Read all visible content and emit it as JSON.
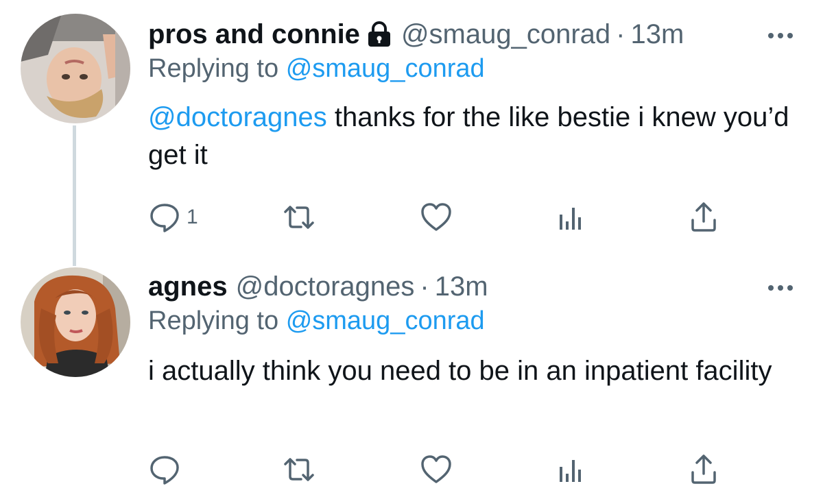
{
  "colors": {
    "text": "#0f1419",
    "secondary": "#536471",
    "link": "#1d9bf0",
    "thread_line": "#cfd9de"
  },
  "tweets": [
    {
      "display_name": "pros and connie",
      "protected_icon": "lock-icon",
      "handle": "@smaug_conrad",
      "separator": "·",
      "time": "13m",
      "replying_prefix": "Replying to",
      "replying_to": "@smaug_conrad",
      "body_mention": "@doctoragnes",
      "body_text": " thanks for the like bestie i knew you’d get it",
      "reply_count": "1"
    },
    {
      "display_name": "agnes",
      "handle": "@doctoragnes",
      "separator": "·",
      "time": "13m",
      "replying_prefix": "Replying to",
      "replying_to": "@smaug_conrad",
      "body_text": "i actually think you need to be in an inpatient facility",
      "reply_count": ""
    }
  ]
}
